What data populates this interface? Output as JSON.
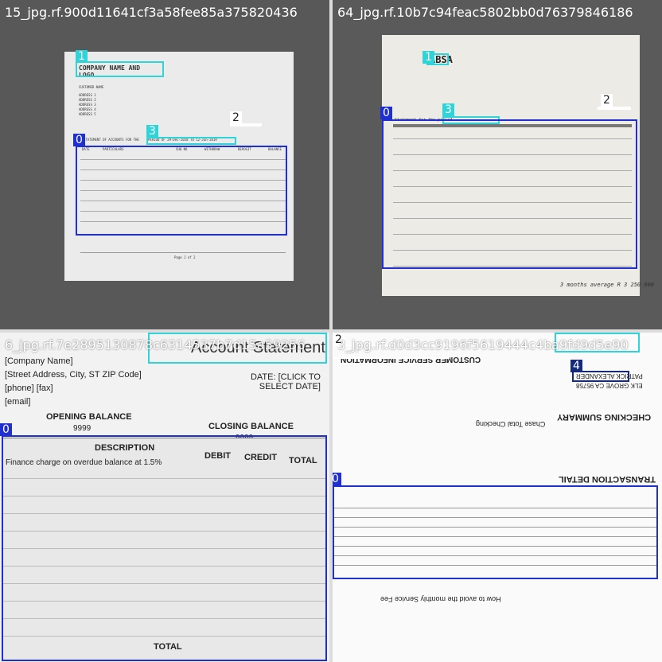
{
  "tiles": [
    {
      "filename": "15_jpg.rf.900d11641cf3a58fee85a375820436",
      "doc": {
        "company": "COMPANY NAME AND LOGO",
        "customer_name": "CUSTOMER NAME",
        "address_lines": [
          "ADDRESS 1",
          "ADDRESS 2",
          "ADDRESS 3",
          "ADDRESS 4",
          "ADDRESS 5"
        ],
        "statement_heading": "STATEMENT OF ACCOUNTS FOR THE",
        "period": "PERIOD OF 29-Dec-2018 TO 12-Jun-2019",
        "columns": [
          "DATE",
          "PARTICULARS",
          "CHQ NO",
          "WITHDRAW",
          "DEPOSIT",
          "BALANCE"
        ],
        "footer": "Page 1 of 2"
      },
      "labels": [
        "0",
        "1",
        "2",
        "3"
      ]
    },
    {
      "filename": "64_jpg.rf.10b7c94feac5802bb0d76379846186",
      "doc": {
        "bank": "ABSA",
        "statement_text": "Statement for the period",
        "handwriting": "3 months average R 3 250 000"
      },
      "labels": [
        "0",
        "1",
        "2",
        "3"
      ]
    },
    {
      "filename": "6_jpg.rf.7e2895130878c6314537b7d15a59256",
      "doc": {
        "title": "Account Statement",
        "company_name": "[Company Name]",
        "street": "[Street Address, City, ST  ZIP Code]",
        "phone_fax": "[phone]  [fax]",
        "email": "[email]",
        "date_label": "DATE: [CLICK TO SELECT DATE]",
        "opening_label": "OPENING BALANCE",
        "opening_value": "9999",
        "closing_label": "CLOSING BALANCE",
        "closing_value": "9999",
        "columns": [
          "DESCRIPTION",
          "DEBIT",
          "CREDIT",
          "TOTAL"
        ],
        "first_row": "Finance charge on overdue balance at 1.5%",
        "total_label": "TOTAL"
      },
      "labels": [
        "0",
        "1"
      ]
    },
    {
      "filename": "3_jpg.rf.d0d3cc9196f5619444c4ba9fd9d5e90",
      "doc": {
        "customer_service": "CUSTOMER SERVICE INFORMATION",
        "checking_summary": "CHECKING SUMMARY",
        "chase_total": "Chase Total Checking",
        "transaction_detail": "TRANSACTION DETAIL",
        "account_holder": "PATRICK ALEXANDER",
        "city": "ELK GROVE CA 95758",
        "bottom_note": "How to avoid the monthly Service Fee"
      },
      "labels": [
        "0",
        "1",
        "2",
        "4"
      ]
    }
  ]
}
